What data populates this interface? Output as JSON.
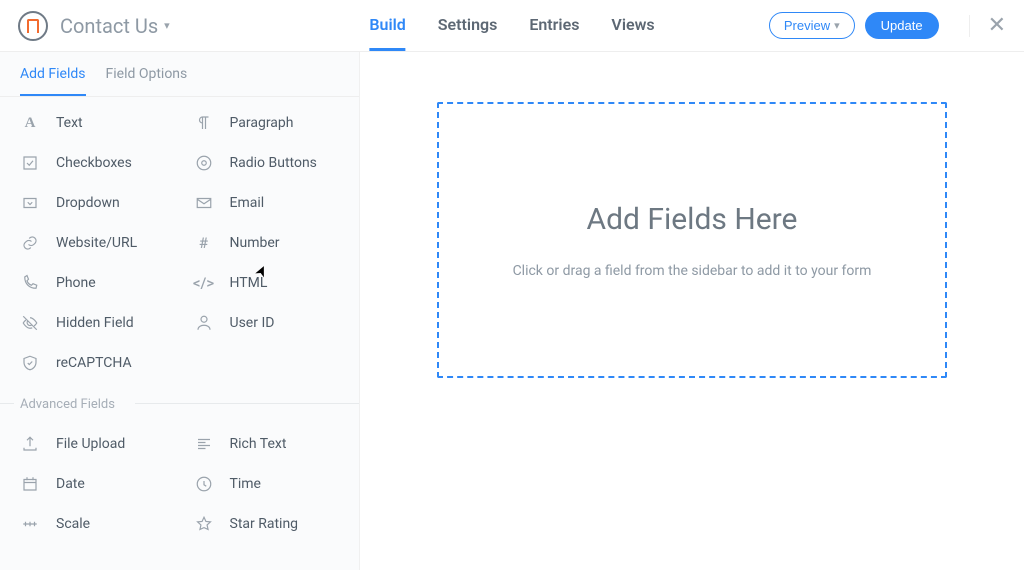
{
  "header": {
    "form_title": "Contact Us",
    "nav": [
      "Build",
      "Settings",
      "Entries",
      "Views"
    ],
    "active_nav_index": 0,
    "preview_label": "Preview",
    "update_label": "Update"
  },
  "sidebar": {
    "tabs": [
      "Add Fields",
      "Field Options"
    ],
    "active_tab_index": 0,
    "basic_fields": [
      {
        "icon": "text-a-icon",
        "label": "Text"
      },
      {
        "icon": "paragraph-icon",
        "label": "Paragraph"
      },
      {
        "icon": "checkbox-icon",
        "label": "Checkboxes"
      },
      {
        "icon": "radio-icon",
        "label": "Radio Buttons"
      },
      {
        "icon": "dropdown-icon",
        "label": "Dropdown"
      },
      {
        "icon": "email-icon",
        "label": "Email"
      },
      {
        "icon": "link-icon",
        "label": "Website/URL"
      },
      {
        "icon": "hash-icon",
        "label": "Number"
      },
      {
        "icon": "phone-icon",
        "label": "Phone"
      },
      {
        "icon": "code-icon",
        "label": "HTML"
      },
      {
        "icon": "hidden-icon",
        "label": "Hidden Field"
      },
      {
        "icon": "user-icon",
        "label": "User ID"
      },
      {
        "icon": "shield-icon",
        "label": "reCAPTCHA"
      }
    ],
    "advanced_header": "Advanced Fields",
    "advanced_fields": [
      {
        "icon": "upload-icon",
        "label": "File Upload"
      },
      {
        "icon": "richtext-icon",
        "label": "Rich Text"
      },
      {
        "icon": "calendar-icon",
        "label": "Date"
      },
      {
        "icon": "clock-icon",
        "label": "Time"
      },
      {
        "icon": "scale-icon",
        "label": "Scale"
      },
      {
        "icon": "star-icon",
        "label": "Star Rating"
      }
    ]
  },
  "canvas": {
    "heading": "Add Fields Here",
    "hint": "Click or drag a field from the sidebar to add it to your form"
  },
  "icons": {
    "text-a-icon": "A",
    "hash-icon": "#",
    "code-icon": "</>"
  }
}
